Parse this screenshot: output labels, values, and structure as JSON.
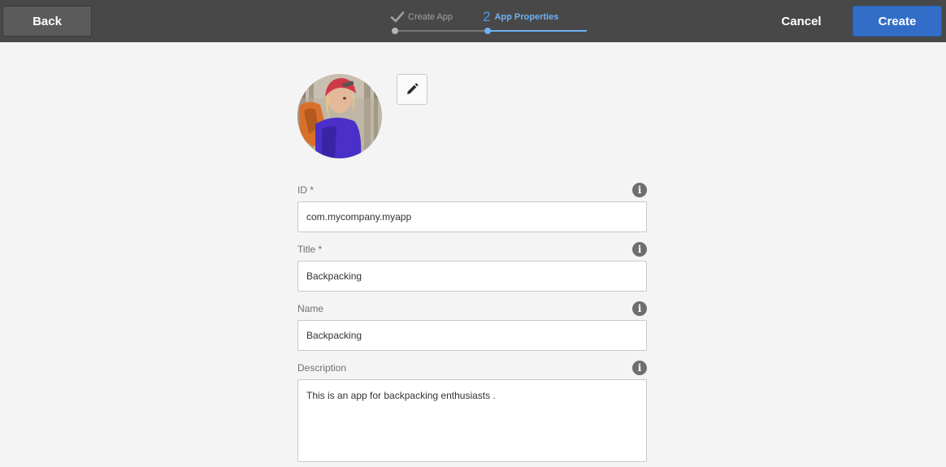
{
  "header": {
    "back_label": "Back",
    "cancel_label": "Cancel",
    "create_label": "Create",
    "steps": [
      {
        "number": "",
        "label": "Create App",
        "status": "completed"
      },
      {
        "number": "2",
        "label": "App Properties",
        "status": "current"
      }
    ]
  },
  "avatar": {
    "icon": "avatar-image",
    "edit_icon": "pencil-icon"
  },
  "fields": {
    "id": {
      "label": "ID *",
      "value": "com.mycompany.myapp"
    },
    "title": {
      "label": "Title *",
      "value": "Backpacking"
    },
    "name": {
      "label": "Name",
      "value": "Backpacking"
    },
    "description": {
      "label": "Description",
      "value": "This is an app for backpacking enthusiasts ."
    }
  },
  "colors": {
    "header_bg": "#484848",
    "primary": "#326ec8",
    "step_active": "#6fb2f2",
    "page_bg": "#f4f4f4"
  }
}
